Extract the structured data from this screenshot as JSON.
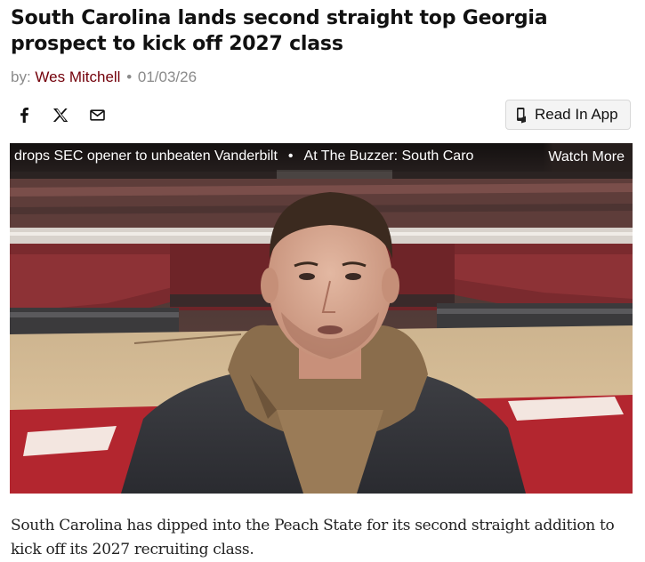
{
  "article": {
    "headline": "South Carolina lands second straight top Georgia prospect to kick off 2027 class",
    "byline_prefix": "by:",
    "author": "Wes Mitchell",
    "separator": "•",
    "date": "01/03/26",
    "lede": "South Carolina has dipped into the Peach State for its second straight addition to kick off its 2027 recruiting class."
  },
  "share": {
    "icons": [
      "facebook-icon",
      "x-icon",
      "email-icon"
    ]
  },
  "app_button": {
    "icon": "phone-icon",
    "label": "Read In App"
  },
  "video": {
    "ticker_items": [
      "drops SEC opener to unbeaten Vanderbilt",
      "At The Buzzer: South Caro"
    ],
    "ticker_separator": "•",
    "watch_more_label": "Watch More"
  }
}
